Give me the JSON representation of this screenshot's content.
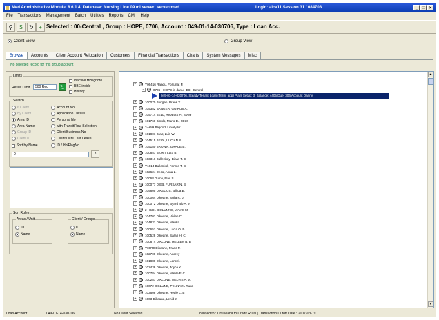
{
  "window": {
    "title": "Med Administrative Module, 8.6.1.4, Database: Nursing Line 09 mi server: serverrmed",
    "title_right": "Login: aica11  Session 31 / 084708"
  },
  "menu": [
    "File",
    "Transactions",
    "Management",
    "Batch",
    "Utilities",
    "Reports",
    "CMI",
    "Help"
  ],
  "toolbar": {
    "selected_text": "Selected : 00-Central , Group : HOPE, 0706, Account : 049-01-14-030706, Type : Loan Acc."
  },
  "view": {
    "client_view": "Client View",
    "group_view": "Group View",
    "selected": "client"
  },
  "tabs": [
    {
      "label": "Browse",
      "active": true
    },
    {
      "label": "Accounts",
      "active": false
    },
    {
      "label": "Client Account Relocation",
      "active": false
    },
    {
      "label": "Customers",
      "active": false
    },
    {
      "label": "Financial Transactions",
      "active": false
    },
    {
      "label": "Charts",
      "active": false
    },
    {
      "label": "System Messages",
      "active": false
    },
    {
      "label": "Misc",
      "active": false
    }
  ],
  "notice": "No selected record for this group account",
  "left": {
    "limits_legend": "Limits",
    "result_limit_label": "Result Limit",
    "result_limit_value": "500 Rec",
    "limits_checks": [
      "Inactive HH ignore",
      "BBE inside",
      "History"
    ],
    "search_legend": "Search",
    "search_left": [
      "If Client",
      "By Client",
      "Area ID",
      "Area Name",
      "Group ID",
      "Client ID",
      "Sort by Name"
    ],
    "search_right": [
      "Account No",
      "Application Details",
      "Personal No",
      "with TransitFlow Selection",
      "Client Business No",
      "Client Date Last Lease",
      "ID / HolFlagNo"
    ],
    "search_value": "0",
    "sort_legend": "Sort Rules",
    "area_legend": "Areas / Unit",
    "client_legend": "Client / Groups",
    "area_options": [
      "ID",
      "Name"
    ],
    "client_options": [
      "ID",
      "Name"
    ]
  },
  "tree": {
    "root": "Y06416 Rangu, Fortunat P.",
    "group": "0706 - HOPE in danu - B8 - Central",
    "selected_account": "049-01-14-030706, Steady Tenant Loan (Term: app) Plant Setup: 3, Balance: 4405 Due: 306 Account Danny",
    "items": [
      "100070 Bungan, Prans Y.",
      "105382 BANGER, GUIRUS A.",
      "105714 BELL, RIOBOS P., Sowe",
      "101760 Binulo, Marlo D., 9D30",
      "2-H5H Bligood, Liniety W.",
      "101801 Brair, Luis W.",
      "104515 BEVA, LUCIAN S.",
      "105180 BROWN, GRACE B.",
      "100857 Brown, Lato B.",
      "103316 Bullenkay, Binas T. C",
      "Y1813 Bullenkol, Fannie T. B",
      "102624 Deco, Anna L.",
      "10068 Dumli, Elas S.",
      "100077 DIEB, FURSAR N. B",
      "109805 DIKELIUS, Billida B.",
      "100064 Dikeane, Sulia R. J",
      "100072 Dikeane, Byard alo A. 9",
      "2-H5H1 DIKLUNNE, MAVIS M.",
      "104702 Dikeane, Vivian C.",
      "104831 Dikeane, Marika.",
      "100651 Dikeane, Lucia O. B",
      "100528 Dikeane, Sarah H. C",
      "100874 DIKLUNE, HELLEN B. B",
      "Y06R0 Dikeane, Franc P.",
      "102700 Dikeane, Audrey",
      "101880 Dikeane, Lancel.",
      "102438 Dikeane, Joyce K.",
      "100784 Dikeane, Mable F. C",
      "100287 DIKLUNE, MELVIS A. V.",
      "10072 DIKLUNE, PENNARL Runn",
      "103608 Dikeane, Hedie L. B",
      "1003 Dikeane, Lenid J."
    ]
  },
  "status": {
    "mode": "Loan Account",
    "account": "049-01-14-030706",
    "client": "No Client Selected",
    "license": "Licensed to : Ursuleana to Credit Rural  |  Transaction Cutoff Date : 2007-03-19"
  }
}
